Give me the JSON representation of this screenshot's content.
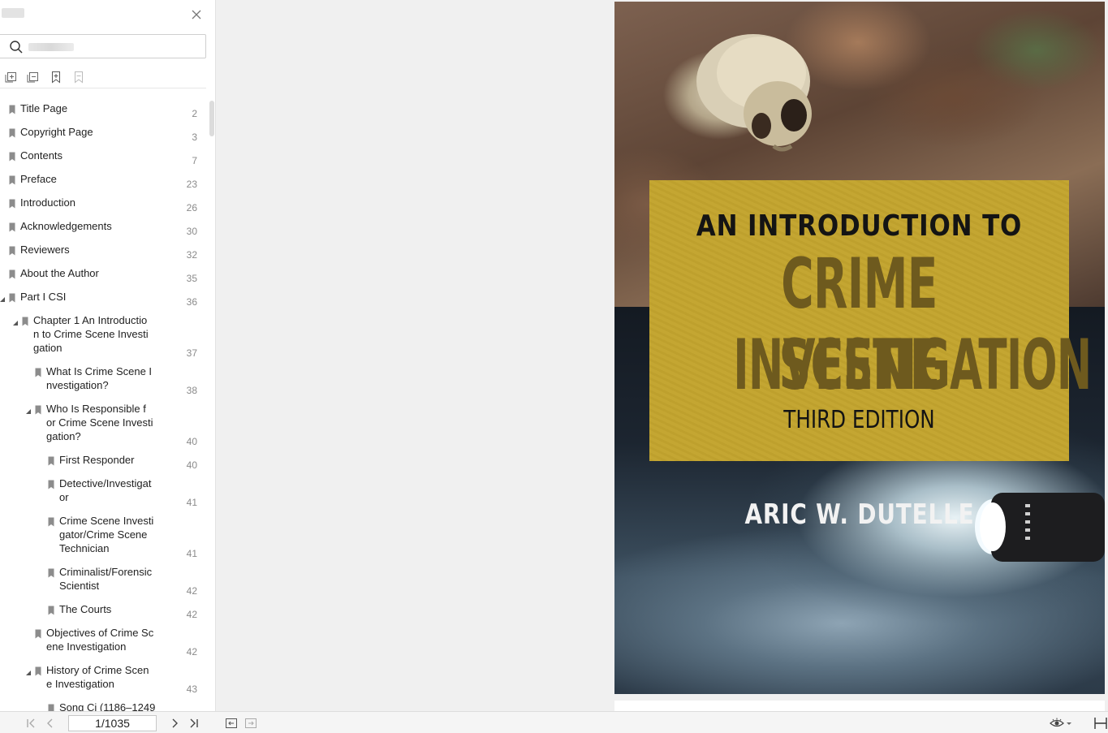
{
  "sidebar": {
    "panel_title": "",
    "search": {
      "placeholder": "",
      "value": ""
    },
    "toc": [
      {
        "label": "Title Page",
        "page": "2"
      },
      {
        "label": "Copyright Page",
        "page": "3"
      },
      {
        "label": "Contents",
        "page": "7"
      },
      {
        "label": "Preface",
        "page": "23"
      },
      {
        "label": "Introduction",
        "page": "26"
      },
      {
        "label": "Acknowledgements",
        "page": "30"
      },
      {
        "label": "Reviewers",
        "page": "32"
      },
      {
        "label": "About the Author",
        "page": "35"
      },
      {
        "label": "Part I CSI",
        "page": "36"
      },
      {
        "label": "Chapter 1 An Introductio\nn to Crime Scene Investi\ngation",
        "page": "37"
      },
      {
        "label": "What Is Crime Scene I\nnvestigation?",
        "page": "38"
      },
      {
        "label": "Who Is Responsible f\nor Crime Scene Investi\ngation?",
        "page": "40"
      },
      {
        "label": "First Responder",
        "page": "40"
      },
      {
        "label": "Detective/Investigat\nor",
        "page": "41"
      },
      {
        "label": "Crime Scene Investi\ngator/Crime Scene\nTechnician",
        "page": "41"
      },
      {
        "label": "Criminalist/Forensic\nScientist",
        "page": "42"
      },
      {
        "label": "The Courts",
        "page": "42"
      },
      {
        "label": "Objectives of Crime Sc\nene Investigation",
        "page": "42"
      },
      {
        "label": "History of Crime Scen\ne Investigation",
        "page": "43"
      },
      {
        "label": "Song Ci (1186–1249",
        "page": ""
      }
    ]
  },
  "cover": {
    "subtitle": "AN INTRODUCTION TO",
    "title_line1": "CRIME SCENE",
    "title_line2": "INVESTIGATION",
    "edition": "THIRD EDITION",
    "author": "ARIC W. DUTELLE"
  },
  "statusbar": {
    "current_page": "1/1035"
  }
}
